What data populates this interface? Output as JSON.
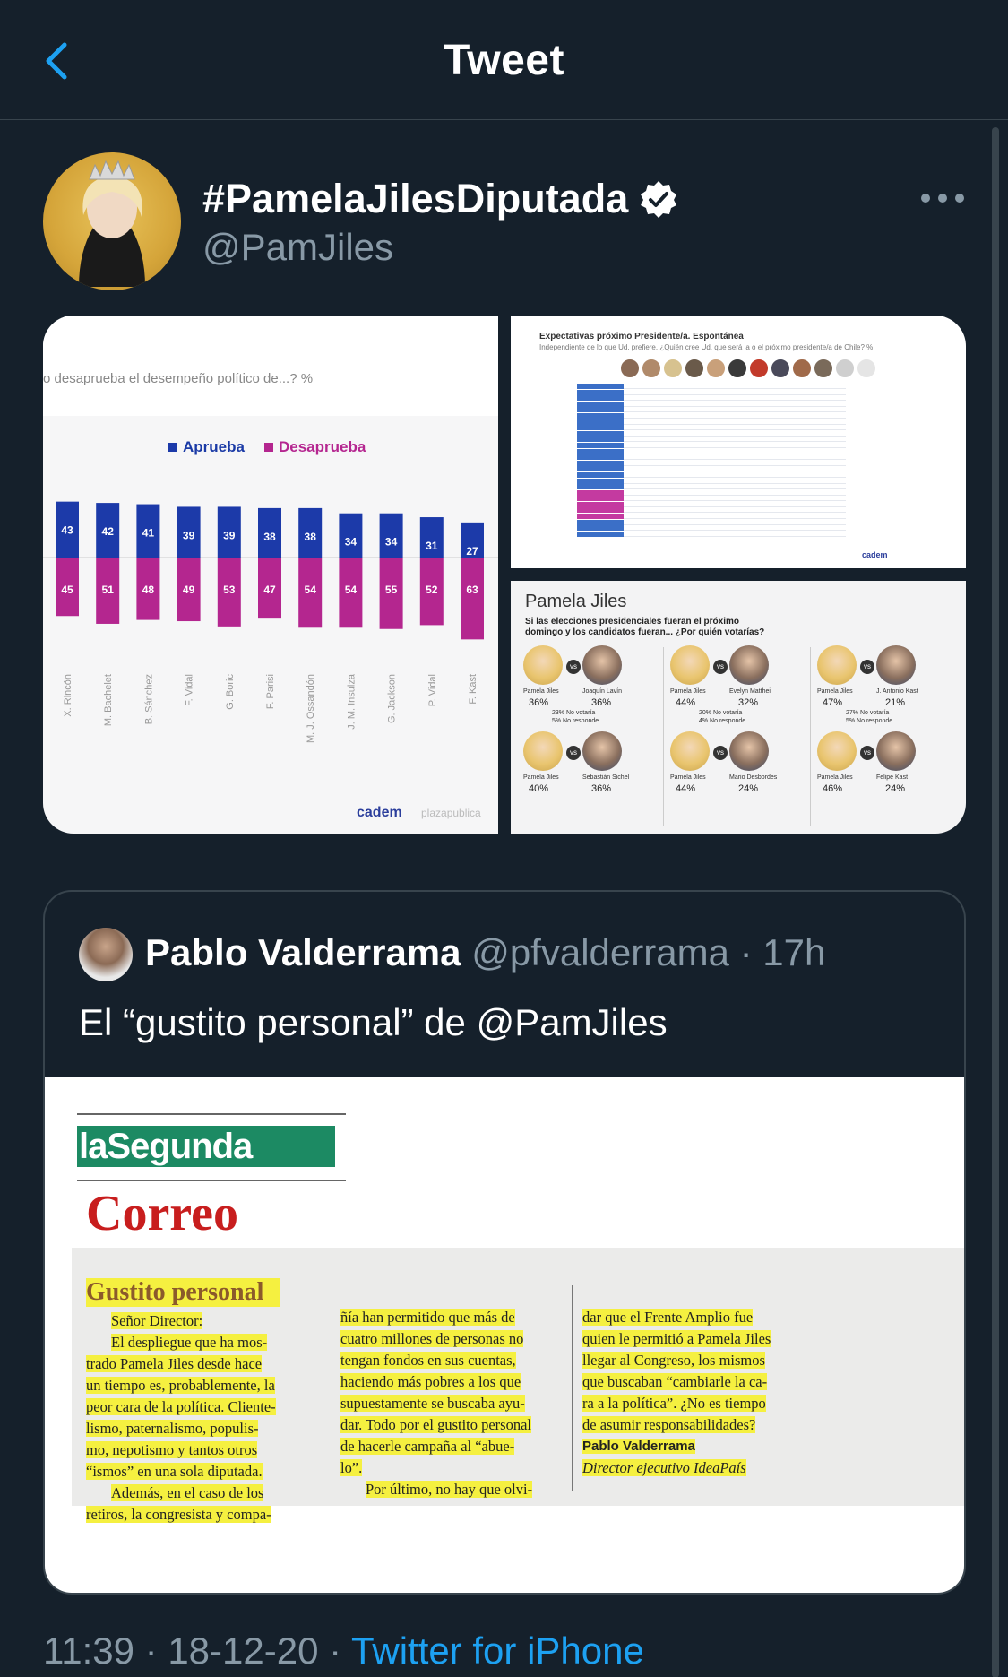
{
  "header": {
    "title": "Tweet"
  },
  "tweet": {
    "display_name": "#PamelaJilesDiputada",
    "handle": "@PamJiles",
    "timestamp_time": "11:39",
    "timestamp_date": "18-12-20",
    "client": "Twitter for iPhone",
    "separator": " · "
  },
  "media": {
    "left": {
      "question": "o desaprueba el desempeño político de...? %",
      "legend_approve": "Aprueba",
      "legend_disapprove": "Desaprueba",
      "colors": {
        "approve": "#1c3aa9",
        "disapprove": "#b4268f"
      },
      "politicians": [
        "X. Rincón",
        "M. Bachelet",
        "B. Sánchez",
        "F. Vidal",
        "G. Boric",
        "F. Parisi",
        "M. J. Ossandón",
        "J. M. Insulza",
        "G. Jackson",
        "P. Vidal",
        "F. Kast"
      ],
      "approve": [
        43,
        42,
        41,
        39,
        39,
        38,
        38,
        34,
        34,
        31,
        27
      ],
      "disapprove": [
        45,
        51,
        48,
        49,
        53,
        47,
        54,
        54,
        55,
        52,
        63
      ],
      "logo": "cadem",
      "logo2": "plazapublica"
    },
    "top_right": {
      "title": "Expectativas próximo Presidente/a. Espontánea",
      "subtitle": "Independiente de lo que Ud. prefiere, ¿Quién cree Ud. que será la o el próximo presidente/a de Chile? %",
      "logo": "cadem"
    },
    "bottom_right": {
      "title": "Pamela Jiles",
      "question": "Si las elecciones presidenciales fueran el próximo domingo y los candidatos fueran... ¿Por quién votarías?",
      "vs": "vs",
      "matchups": [
        {
          "a": "Pamela Jiles",
          "a_pct": "36%",
          "b": "Joaquín Lavín",
          "b_pct": "36%",
          "note1": "23% No votaría",
          "note2": "5% No responde"
        },
        {
          "a": "Pamela Jiles",
          "a_pct": "44%",
          "b": "Evelyn Matthei",
          "b_pct": "32%",
          "note1": "20% No votaría",
          "note2": "4% No responde"
        },
        {
          "a": "Pamela Jiles",
          "a_pct": "47%",
          "b": "J. Antonio Kast",
          "b_pct": "21%",
          "note1": "27% No votaría",
          "note2": "5% No responde"
        },
        {
          "a": "Pamela Jiles",
          "a_pct": "40%",
          "b": "Sebastián Sichel",
          "b_pct": "36%"
        },
        {
          "a": "Pamela Jiles",
          "a_pct": "44%",
          "b": "Mario Desbordes",
          "b_pct": "24%"
        },
        {
          "a": "Pamela Jiles",
          "a_pct": "46%",
          "b": "Felipe Kast",
          "b_pct": "24%"
        }
      ]
    }
  },
  "quote": {
    "name": "Pablo Valderrama",
    "handle": "@pfvalderrama",
    "age": "17h",
    "text": "El “gustito personal” de @PamJiles",
    "clip": {
      "masthead": "laSegunda",
      "section": "Correo",
      "headline": "Gustito personal",
      "col1": [
        "Señor Director:",
        "El despliegue que ha mos-",
        "trado Pamela Jiles desde hace",
        "un tiempo es, probablemente, la",
        "peor cara de la política. Cliente-",
        "lismo, paternalismo, populis-",
        "mo, nepotismo y tantos otros",
        "“ismos” en una sola diputada.",
        "Además, en el caso de los",
        "retiros, la congresista y compa-"
      ],
      "col2": [
        "ñía han permitido que más de",
        "cuatro millones de personas no",
        "tengan fondos en sus cuentas,",
        "haciendo más pobres a los que",
        "supuestamente se buscaba ayu-",
        "dar. Todo por el gustito personal",
        "de hacerle campaña al “abue-",
        "lo”.",
        "Por último, no hay que olvi-"
      ],
      "col3": [
        "dar que el Frente Amplio fue",
        "quien le permitió a Pamela Jiles",
        "llegar al Congreso, los mismos",
        "que buscaban “cambiarle la ca-",
        "ra a la política”. ¿No es tiempo",
        "de asumir responsabilidades?"
      ],
      "signature": "Pablo Valderrama",
      "signature_role": "Director ejecutivo IdeaPaís"
    }
  }
}
